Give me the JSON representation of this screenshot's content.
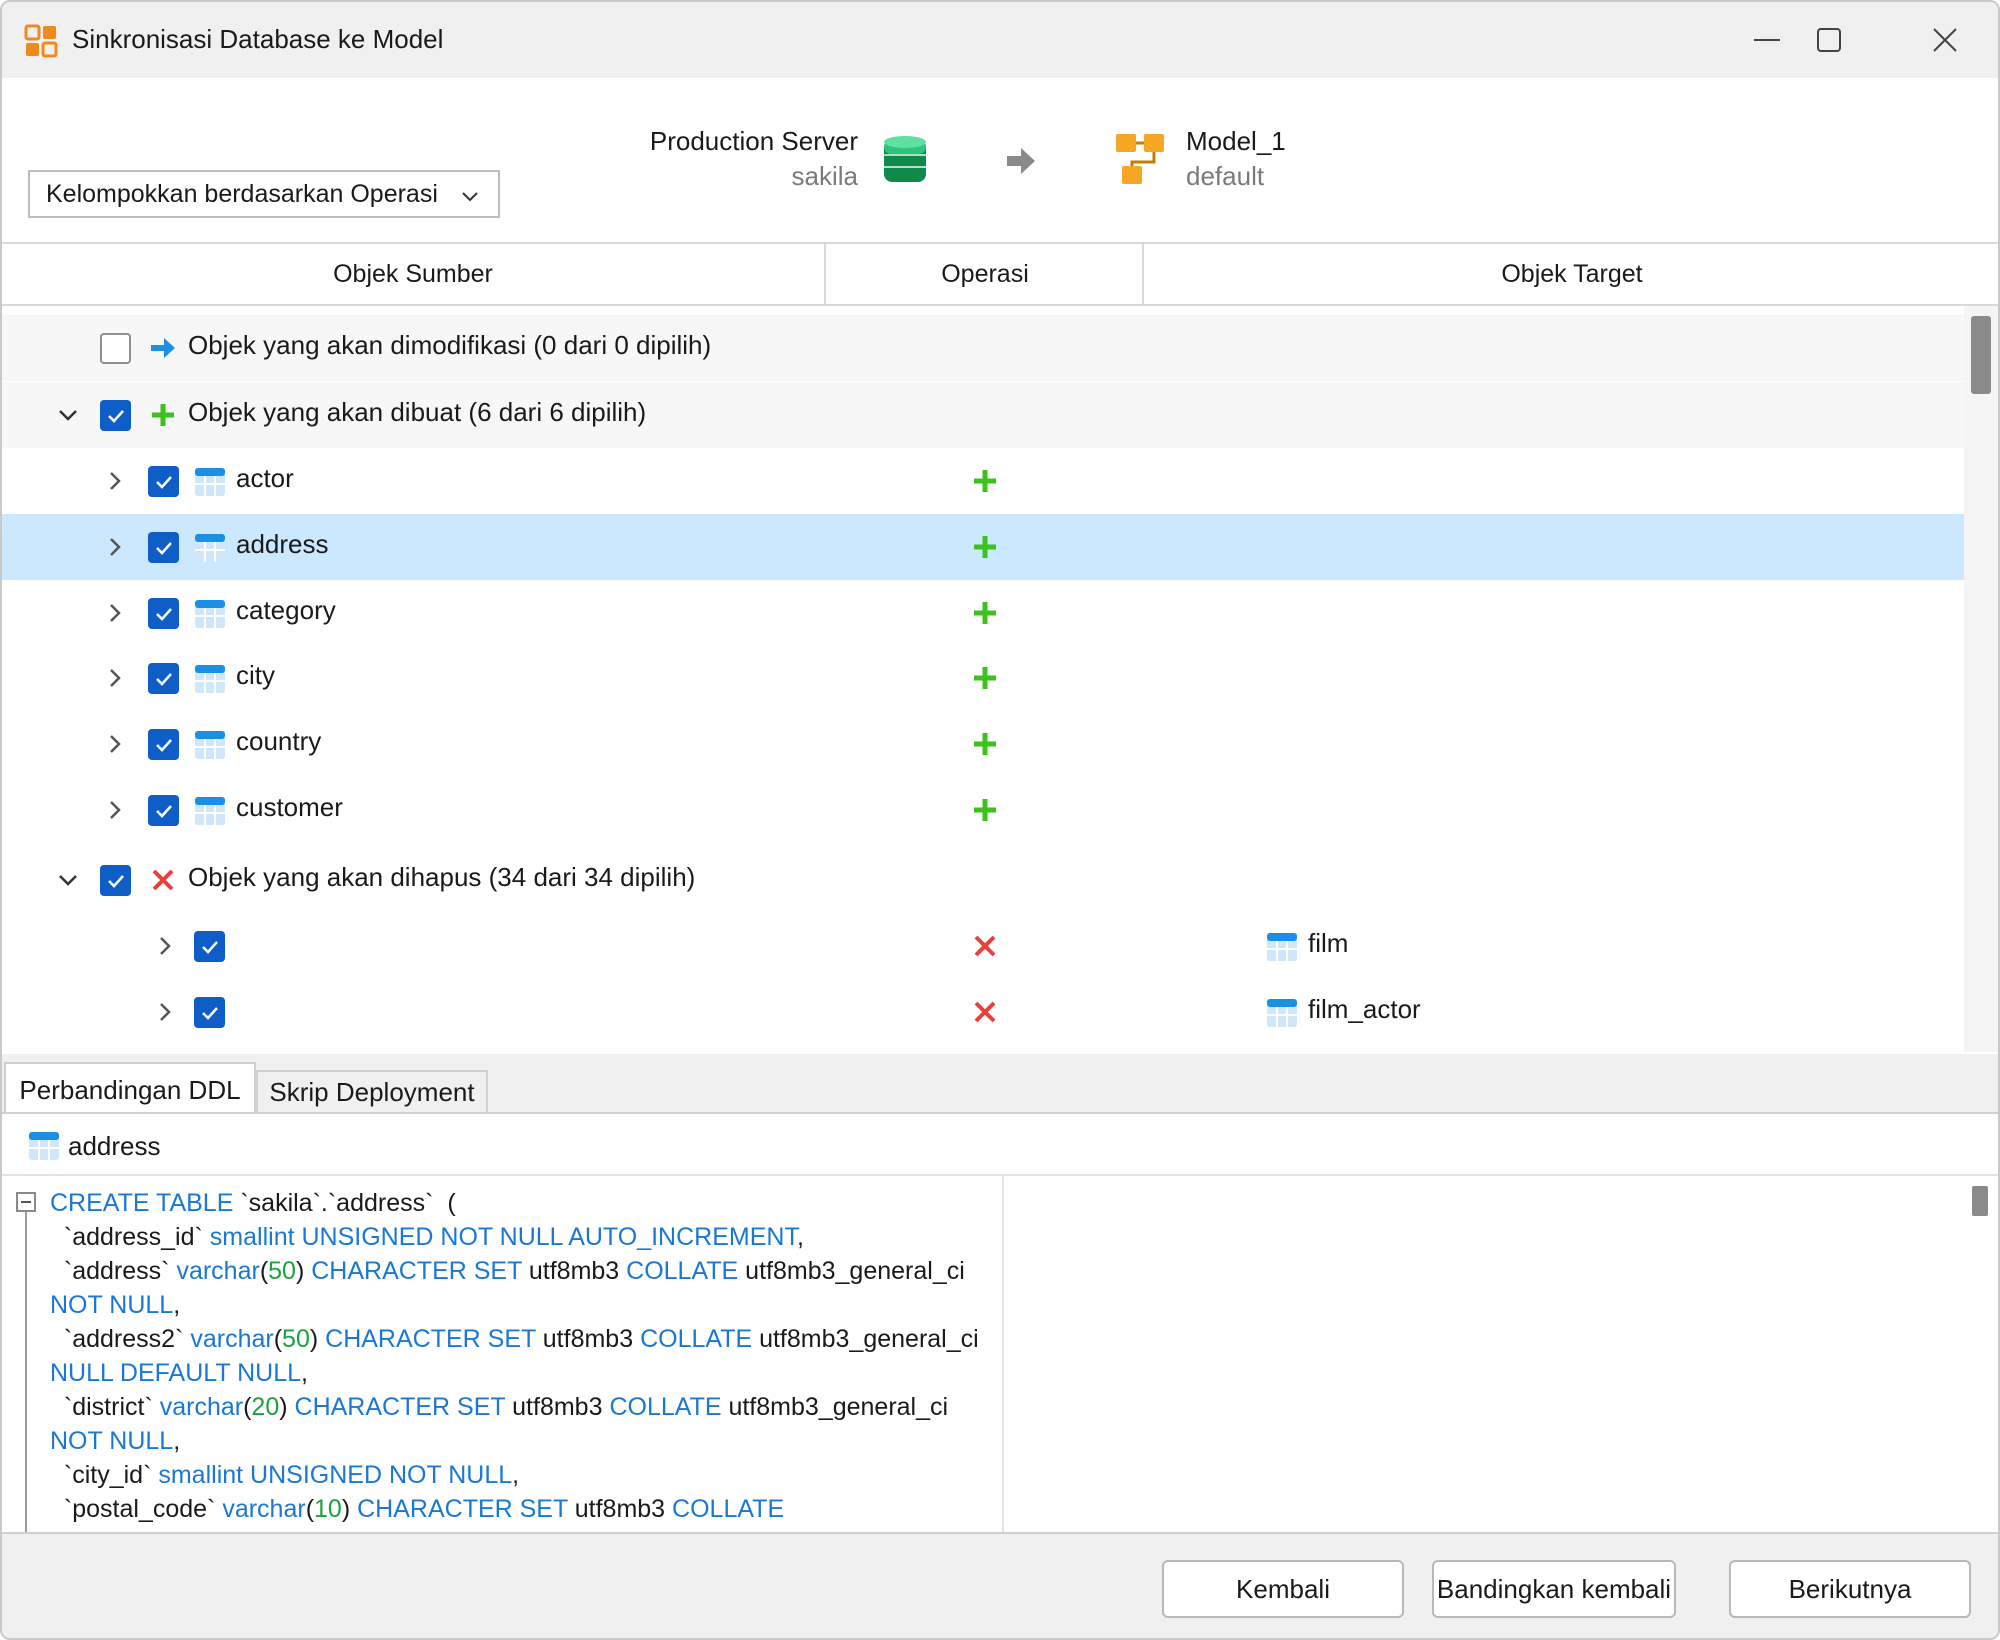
{
  "window": {
    "title": "Sinkronisasi Database ke Model"
  },
  "header": {
    "group_by": "Kelompokkan berdasarkan Operasi",
    "source": {
      "name": "Production Server",
      "database": "sakila"
    },
    "target": {
      "name": "Model_1",
      "sub": "default"
    }
  },
  "columns": {
    "source": "Objek Sumber",
    "operation": "Operasi",
    "target": "Objek Target"
  },
  "groups": {
    "modify": "Objek yang akan dimodifikasi (0 dari 0 dipilih)",
    "create": "Objek yang akan dibuat (6 dari 6 dipilih)",
    "delete": "Objek yang akan dihapus (34 dari 34 dipilih)"
  },
  "create_items": [
    "actor",
    "address",
    "category",
    "city",
    "country",
    "customer"
  ],
  "delete_items": [
    "film",
    "film_actor"
  ],
  "tabs": {
    "ddl": "Perbandingan DDL",
    "deploy": "Skrip Deployment"
  },
  "detail": {
    "object": "address"
  },
  "footer": {
    "back": "Kembali",
    "compare": "Bandingkan kembali",
    "next": "Berikutnya"
  },
  "colors": {
    "accent": "#0f5ec8",
    "selected_row": "#cce8ff",
    "keyword": "#1a78d4",
    "number": "#1aa33b",
    "create": "#3cc21e",
    "delete": "#e8403a"
  },
  "icons": [
    "app-logo-icon",
    "database-icon",
    "arrow-right-icon",
    "model-icon",
    "table-icon",
    "plus-icon",
    "x-icon",
    "checkbox-icon",
    "chevron-right-icon",
    "chevron-down-icon"
  ]
}
